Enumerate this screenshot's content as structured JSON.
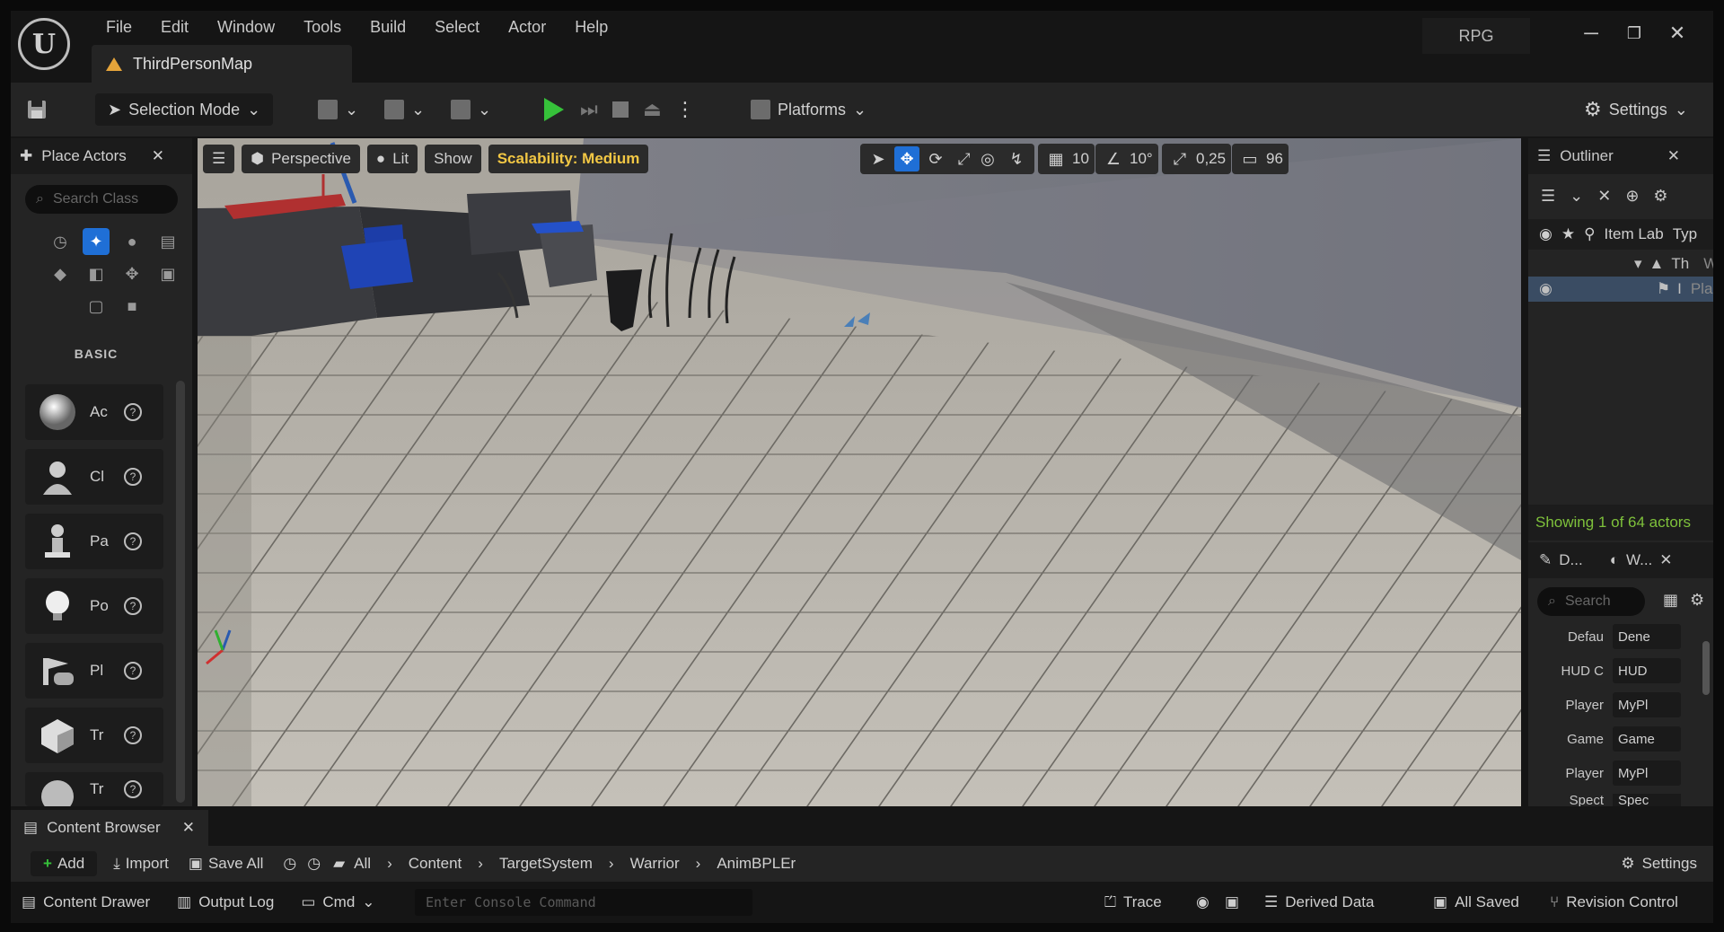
{
  "menu": [
    "File",
    "Edit",
    "Window",
    "Tools",
    "Build",
    "Select",
    "Actor",
    "Help"
  ],
  "map_tab": "ThirdPersonMap",
  "project": "RPG",
  "toolbar": {
    "selection_mode": "Selection Mode",
    "platforms": "Platforms",
    "settings": "Settings"
  },
  "place_actors": {
    "title": "Place Actors",
    "search_placeholder": "Search Class",
    "category": "BASIC",
    "items": [
      {
        "label": "Ac",
        "icon": "sphere-icon"
      },
      {
        "label": "Cl",
        "icon": "character-icon"
      },
      {
        "label": "Pa",
        "icon": "pawn-icon"
      },
      {
        "label": "Po",
        "icon": "light-icon"
      },
      {
        "label": "Pl",
        "icon": "player-start-icon"
      },
      {
        "label": "Tr",
        "icon": "trigger-box-icon"
      },
      {
        "label": "Tr",
        "icon": "trigger-sphere-icon"
      }
    ]
  },
  "viewport": {
    "perspective": "Perspective",
    "lit": "Lit",
    "show": "Show",
    "scalability": "Scalability: Medium",
    "grid_snap": "10",
    "rot_snap": "10°",
    "scale_snap": "0,25",
    "camera_speed": "96"
  },
  "outliner": {
    "title": "Outliner",
    "col_label": "Item Lab",
    "col_type": "Typ",
    "row1_label": "Th",
    "row1_type": "Wo",
    "row2_label": "I",
    "row2_type": "Pla",
    "showing": "Showing 1 of 64 actors"
  },
  "details": {
    "tab1": "D...",
    "tab2": "W...",
    "search_placeholder": "Search",
    "rows": [
      {
        "k": "Defau",
        "v": "Dene"
      },
      {
        "k": "HUD C",
        "v": "HUD"
      },
      {
        "k": "Player",
        "v": "MyPl"
      },
      {
        "k": "Game",
        "v": "Game"
      },
      {
        "k": "Player",
        "v": "MyPl"
      },
      {
        "k": "Spect",
        "v": "Spec"
      }
    ]
  },
  "content_browser": {
    "title": "Content Browser",
    "add": "Add",
    "import": "Import",
    "save_all": "Save All",
    "breadcrumb": [
      "All",
      "Content",
      "TargetSystem",
      "Warrior",
      "AnimBPLEr"
    ],
    "settings": "Settings"
  },
  "status": {
    "content_drawer": "Content Drawer",
    "output_log": "Output Log",
    "cmd": "Cmd",
    "console_placeholder": "Enter Console Command",
    "trace": "Trace",
    "derived_data": "Derived Data",
    "all_saved": "All Saved",
    "revision_control": "Revision Control"
  },
  "colors": {
    "accent_blue": "#1f6fd6",
    "play_green": "#36c13a",
    "scalability_yellow": "#f2c744",
    "showing_green": "#7ec13b",
    "warning_orange": "#e5a43a"
  }
}
